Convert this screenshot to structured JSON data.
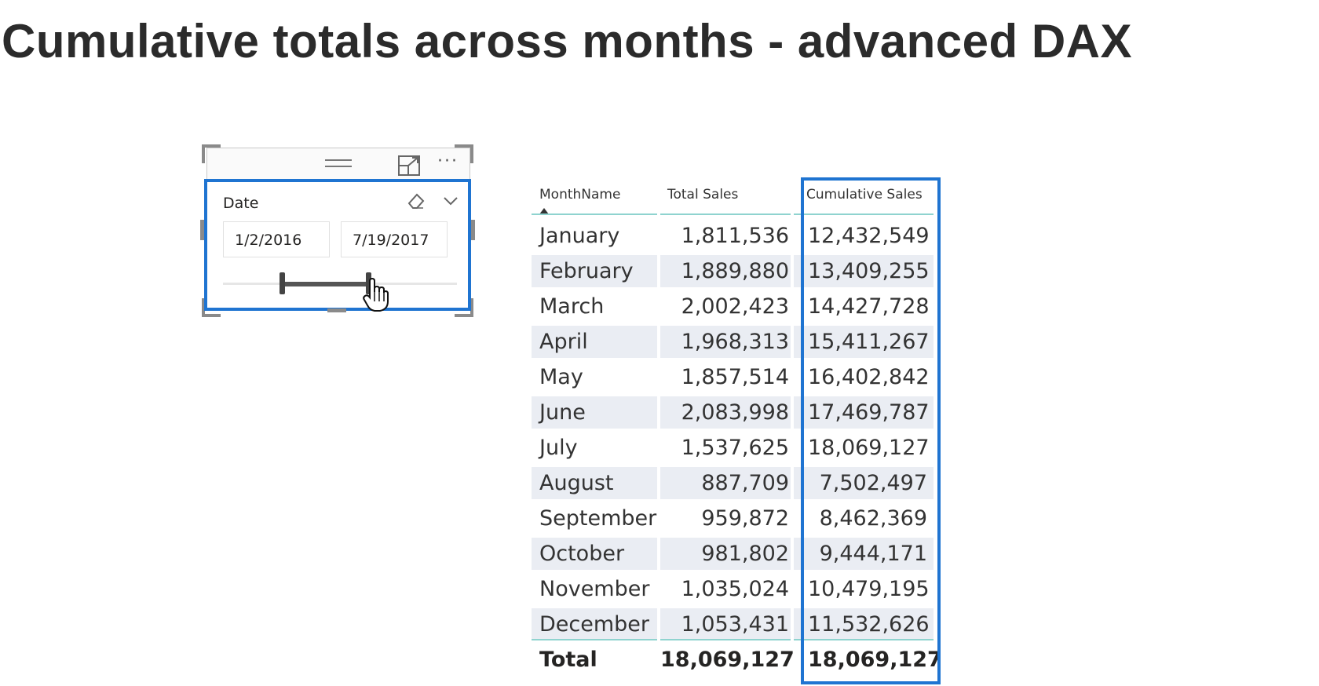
{
  "title": "Cumulative totals across months - advanced DAX",
  "slicer": {
    "label": "Date",
    "start_date": "1/2/2016",
    "end_date": "7/19/2017",
    "more_label": "···",
    "range_start_fraction": 0.25,
    "range_end_fraction": 0.62,
    "icons": [
      "drag-grip-icon",
      "focus-mode-icon",
      "more-options-icon",
      "eraser-icon",
      "chevron-down-icon",
      "hand-cursor-icon"
    ]
  },
  "table": {
    "columns": [
      "MonthName",
      "Total Sales",
      "Cumulative Sales"
    ],
    "sorted_column": "MonthName",
    "rows": [
      {
        "month": "January",
        "total": "1,811,536",
        "cumulative": "12,432,549"
      },
      {
        "month": "February",
        "total": "1,889,880",
        "cumulative": "13,409,255"
      },
      {
        "month": "March",
        "total": "2,002,423",
        "cumulative": "14,427,728"
      },
      {
        "month": "April",
        "total": "1,968,313",
        "cumulative": "15,411,267"
      },
      {
        "month": "May",
        "total": "1,857,514",
        "cumulative": "16,402,842"
      },
      {
        "month": "June",
        "total": "2,083,998",
        "cumulative": "17,469,787"
      },
      {
        "month": "July",
        "total": "1,537,625",
        "cumulative": "18,069,127"
      },
      {
        "month": "August",
        "total": "887,709",
        "cumulative": "7,502,497"
      },
      {
        "month": "September",
        "total": "959,872",
        "cumulative": "8,462,369"
      },
      {
        "month": "October",
        "total": "981,802",
        "cumulative": "9,444,171"
      },
      {
        "month": "November",
        "total": "1,035,024",
        "cumulative": "10,479,195"
      },
      {
        "month": "December",
        "total": "1,053,431",
        "cumulative": "11,532,626"
      }
    ],
    "total_row": {
      "label": "Total",
      "total": "18,069,127",
      "cumulative": "18,069,127"
    }
  },
  "colors": {
    "highlight_border": "#1f74d1",
    "alt_row": "#eaedf3",
    "header_line": "#8fd3cf"
  }
}
